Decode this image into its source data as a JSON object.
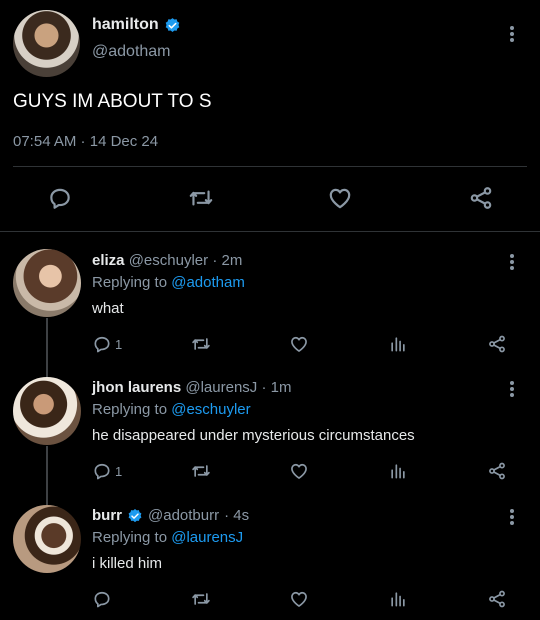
{
  "main_tweet": {
    "display_name": "hamilton",
    "handle": "@adotham",
    "text": "GUYS IM ABOUT TO S",
    "time": "07:54 AM",
    "date_sep": " · ",
    "date": "14 Dec 24"
  },
  "replies": [
    {
      "display_name": "eliza",
      "handle": "@eschuyler",
      "time": "· 2m",
      "replying_prefix": "Replying to",
      "replying_to": "@adotham",
      "text": "what",
      "reply_count": "1"
    },
    {
      "display_name": "jhon laurens",
      "handle": "@laurensJ",
      "time": "· 1m",
      "replying_prefix": "Replying to",
      "replying_to": "@eschuyler",
      "text": "he disappeared under mysterious circumstances",
      "reply_count": "1"
    },
    {
      "display_name": "burr",
      "handle": "@adotburr",
      "time": "· 4s",
      "replying_prefix": "Replying to",
      "replying_to": "@laurensJ",
      "text": "i killed him",
      "reply_count": ""
    }
  ],
  "colors": {
    "background": "#000000",
    "accent": "#1d9bf0",
    "muted": "#8b98a5",
    "text": "#e7e9ea",
    "divider": "#2f3336"
  },
  "icons": [
    "verified-badge-icon",
    "more-icon",
    "reply-icon",
    "retweet-icon",
    "like-icon",
    "share-icon",
    "analytics-icon"
  ]
}
